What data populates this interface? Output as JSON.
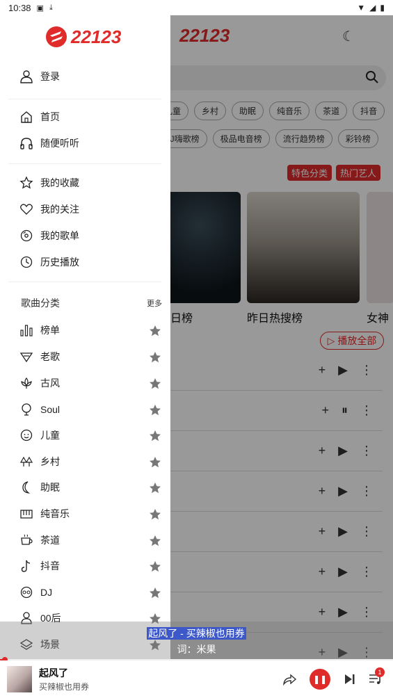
{
  "status_bar": {
    "time": "10:38"
  },
  "brand": {
    "logo_text": "22123",
    "accent": "#e02b2b"
  },
  "drawer": {
    "login": "登录",
    "nav": [
      {
        "label": "首页",
        "icon": "home-icon"
      },
      {
        "label": "随便听听",
        "icon": "headphones-icon"
      }
    ],
    "personal": [
      {
        "label": "我的收藏",
        "icon": "star-outline-icon"
      },
      {
        "label": "我的关注",
        "icon": "heart-icon"
      },
      {
        "label": "我的歌单",
        "icon": "disc-icon"
      },
      {
        "label": "历史播放",
        "icon": "clock-icon"
      }
    ],
    "section_title": "歌曲分类",
    "more": "更多",
    "categories": [
      {
        "label": "榜单",
        "icon": "chart-icon"
      },
      {
        "label": "老歌",
        "icon": "oldsong-icon"
      },
      {
        "label": "古风",
        "icon": "lotus-icon"
      },
      {
        "label": "Soul",
        "icon": "soul-icon"
      },
      {
        "label": "儿童",
        "icon": "child-icon"
      },
      {
        "label": "乡村",
        "icon": "tree-icon"
      },
      {
        "label": "助眠",
        "icon": "moon-icon"
      },
      {
        "label": "纯音乐",
        "icon": "piano-icon"
      },
      {
        "label": "茶道",
        "icon": "tea-icon"
      },
      {
        "label": "抖音",
        "icon": "tiktok-icon"
      },
      {
        "label": "DJ",
        "icon": "dj-icon"
      },
      {
        "label": "00后",
        "icon": "user-icon"
      },
      {
        "label": "场景",
        "icon": "layers-icon"
      }
    ]
  },
  "background": {
    "chips_row1": [
      "儿童",
      "乡村",
      "助眠",
      "纯音乐",
      "茶道",
      "抖音"
    ],
    "chips_row2": [
      "DJ嗨歌榜",
      "极品电音榜",
      "流行趋势榜",
      "彩铃榜"
    ],
    "tags": [
      "特色分类",
      "热门艺人"
    ],
    "albums": [
      "日榜",
      "昨日热搜榜",
      "女神"
    ],
    "play_all": "播放全部"
  },
  "lyric": {
    "line1": "起风了 - 买辣椒也用券",
    "line2": "词：米果"
  },
  "player": {
    "title": "起风了",
    "artist": "买辣椒也用券",
    "queue_count": "1",
    "progress": 0.01
  }
}
